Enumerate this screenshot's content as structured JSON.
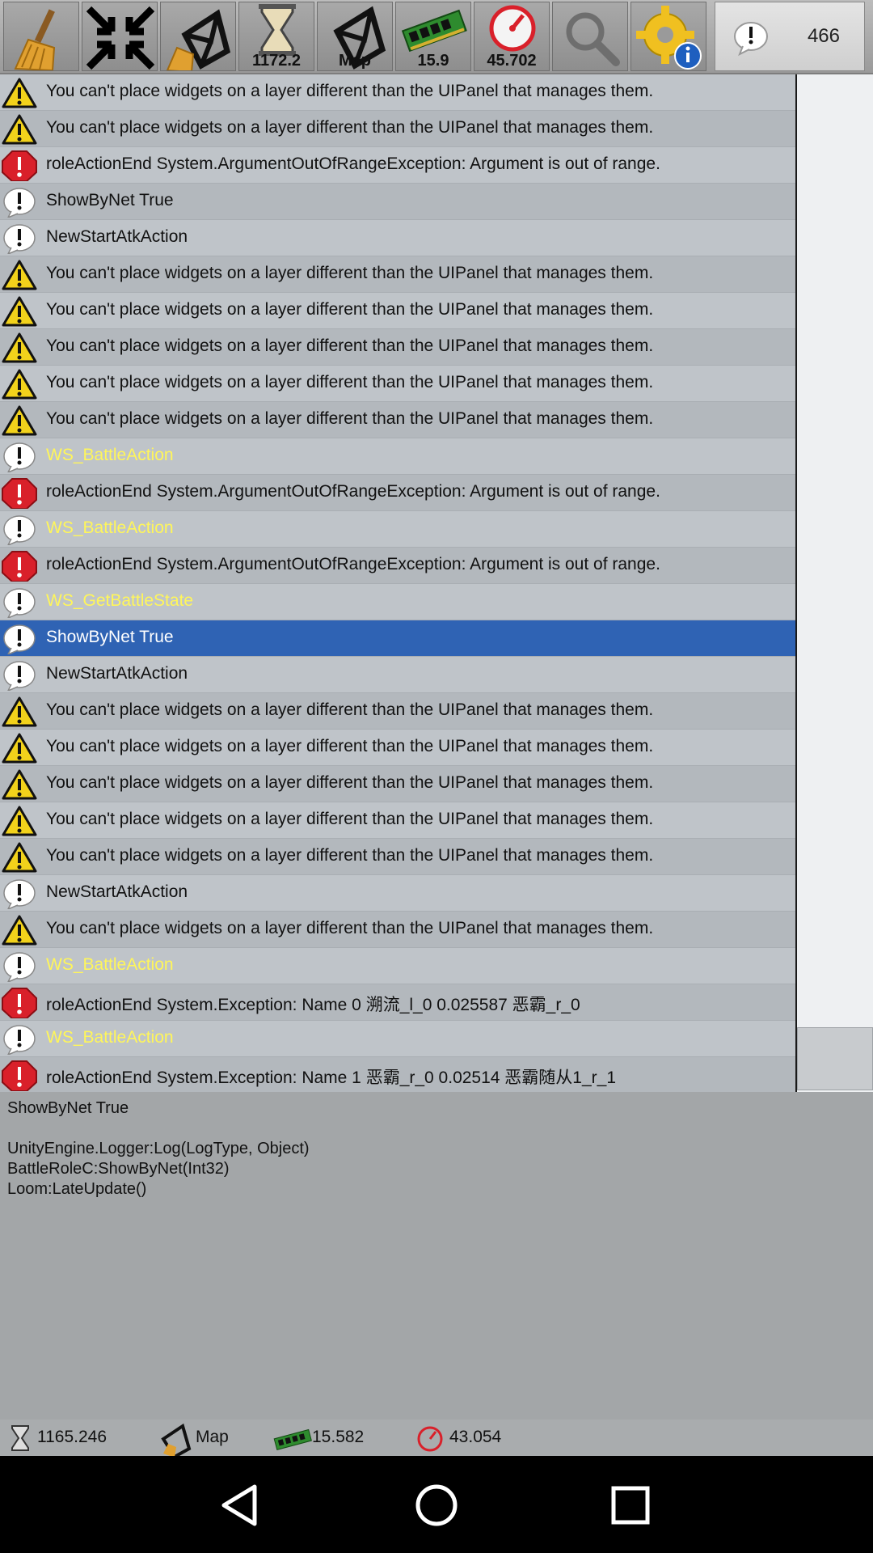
{
  "toolbar": {
    "buttons": [
      {
        "name": "clear",
        "icon": "broom-icon",
        "value": ""
      },
      {
        "name": "collapse",
        "icon": "collapse-arrows-icon",
        "value": ""
      },
      {
        "name": "unity-scene",
        "icon": "unity-broom-icon",
        "value": ""
      },
      {
        "name": "time",
        "icon": "hourglass-icon",
        "value": "1172.2"
      },
      {
        "name": "scene",
        "icon": "unity-logo-icon",
        "value": "Map"
      },
      {
        "name": "memory",
        "icon": "memory-chip-icon",
        "value": "15.9"
      },
      {
        "name": "fps",
        "icon": "speedometer-icon",
        "value": "45.702"
      },
      {
        "name": "search",
        "icon": "magnifier-icon",
        "value": ""
      },
      {
        "name": "settings",
        "icon": "gear-info-icon",
        "value": ""
      }
    ],
    "log_count": "466"
  },
  "logs": [
    {
      "type": "warning",
      "text": "You can't place widgets on a layer different than the UIPanel that manages them."
    },
    {
      "type": "warning",
      "text": "You can't place widgets on a layer different than the UIPanel that manages them."
    },
    {
      "type": "error",
      "text": "roleActionEnd System.ArgumentOutOfRangeException: Argument is out of range."
    },
    {
      "type": "info",
      "text": "ShowByNet True"
    },
    {
      "type": "info",
      "text": "NewStartAtkAction"
    },
    {
      "type": "warning",
      "text": "You can't place widgets on a layer different than the UIPanel that manages them."
    },
    {
      "type": "warning",
      "text": "You can't place widgets on a layer different than the UIPanel that manages them."
    },
    {
      "type": "warning",
      "text": "You can't place widgets on a layer different than the UIPanel that manages them."
    },
    {
      "type": "warning",
      "text": "You can't place widgets on a layer different than the UIPanel that manages them."
    },
    {
      "type": "warning",
      "text": "You can't place widgets on a layer different than the UIPanel that manages them."
    },
    {
      "type": "info",
      "text": "WS_BattleAction",
      "highlight": true
    },
    {
      "type": "error",
      "text": "roleActionEnd System.ArgumentOutOfRangeException: Argument is out of range."
    },
    {
      "type": "info",
      "text": "WS_BattleAction",
      "highlight": true
    },
    {
      "type": "error",
      "text": "roleActionEnd System.ArgumentOutOfRangeException: Argument is out of range."
    },
    {
      "type": "info",
      "text": "WS_GetBattleState",
      "highlight": true
    },
    {
      "type": "info",
      "text": "ShowByNet True",
      "selected": true
    },
    {
      "type": "info",
      "text": "NewStartAtkAction"
    },
    {
      "type": "warning",
      "text": "You can't place widgets on a layer different than the UIPanel that manages them."
    },
    {
      "type": "warning",
      "text": "You can't place widgets on a layer different than the UIPanel that manages them."
    },
    {
      "type": "warning",
      "text": "You can't place widgets on a layer different than the UIPanel that manages them."
    },
    {
      "type": "warning",
      "text": "You can't place widgets on a layer different than the UIPanel that manages them."
    },
    {
      "type": "warning",
      "text": "You can't place widgets on a layer different than the UIPanel that manages them."
    },
    {
      "type": "info",
      "text": "NewStartAtkAction"
    },
    {
      "type": "warning",
      "text": "You can't place widgets on a layer different than the UIPanel that manages them."
    },
    {
      "type": "info",
      "text": "WS_BattleAction",
      "highlight": true
    },
    {
      "type": "error",
      "text": "roleActionEnd System.Exception: Name 0 溯流_l_0 0.025587 恶霸_r_0"
    },
    {
      "type": "info",
      "text": "WS_BattleAction",
      "highlight": true
    },
    {
      "type": "error",
      "text": "roleActionEnd System.Exception: Name 1 恶霸_r_0 0.02514 恶霸随从1_r_1"
    }
  ],
  "detail": {
    "text": "ShowByNet True\n\nUnityEngine.Logger:Log(LogType, Object)\nBattleRoleC:ShowByNet(Int32)\nLoom:LateUpdate()"
  },
  "statusbar": {
    "time": "1165.246",
    "scene": "Map",
    "memory": "15.582",
    "fps": "43.054"
  },
  "colors": {
    "selected_row": "#2f63b4",
    "highlight_text": "#fff65a",
    "error_red": "#d9202a",
    "warning_yellow": "#f2d21b"
  },
  "nav": {
    "back": "back-icon",
    "home": "home-icon",
    "recents": "recents-icon"
  }
}
